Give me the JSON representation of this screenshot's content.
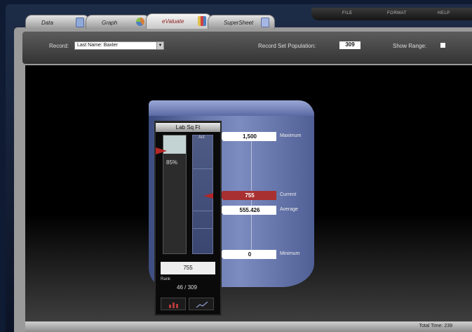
{
  "tabs": [
    {
      "label": "Data",
      "icon": "spreadsheet-icon",
      "color": "#8fa9d8"
    },
    {
      "label": "Graph",
      "icon": "pie-chart-icon",
      "color": "#d47f3c"
    },
    {
      "label": "eValuate",
      "icon": "evaluate-icon",
      "color": "#e0c04a"
    },
    {
      "label": "SuperSheet",
      "icon": "supersheet-icon",
      "color": "#a7b7e3"
    }
  ],
  "menu": [
    "FILE",
    "FORMAT",
    "HELP"
  ],
  "toolbar": {
    "record_label": "Record:",
    "record_value": "Last Name: Baxter",
    "population_label": "Record Set Population:",
    "population_value": "309",
    "show_range_label": "Show Range:"
  },
  "gauge": {
    "title": "Lab Sq Ft",
    "percentile": "85%",
    "bar2_label": "Act",
    "value": "755",
    "rank_label": "Rank",
    "rank": "46 / 309",
    "fill_fraction": 0.85
  },
  "range": {
    "maximum_value": "1,500",
    "maximum_label": "Maximum",
    "current_value": "755",
    "current_label": "Current",
    "average_value": "555.426",
    "average_label": "Average",
    "minimum_value": "0",
    "minimum_label": "Minimum"
  },
  "status": {
    "text": "Total Time: 239"
  },
  "colors": {
    "accent_red": "#b52525",
    "cylinder": "#6b7bb0"
  }
}
